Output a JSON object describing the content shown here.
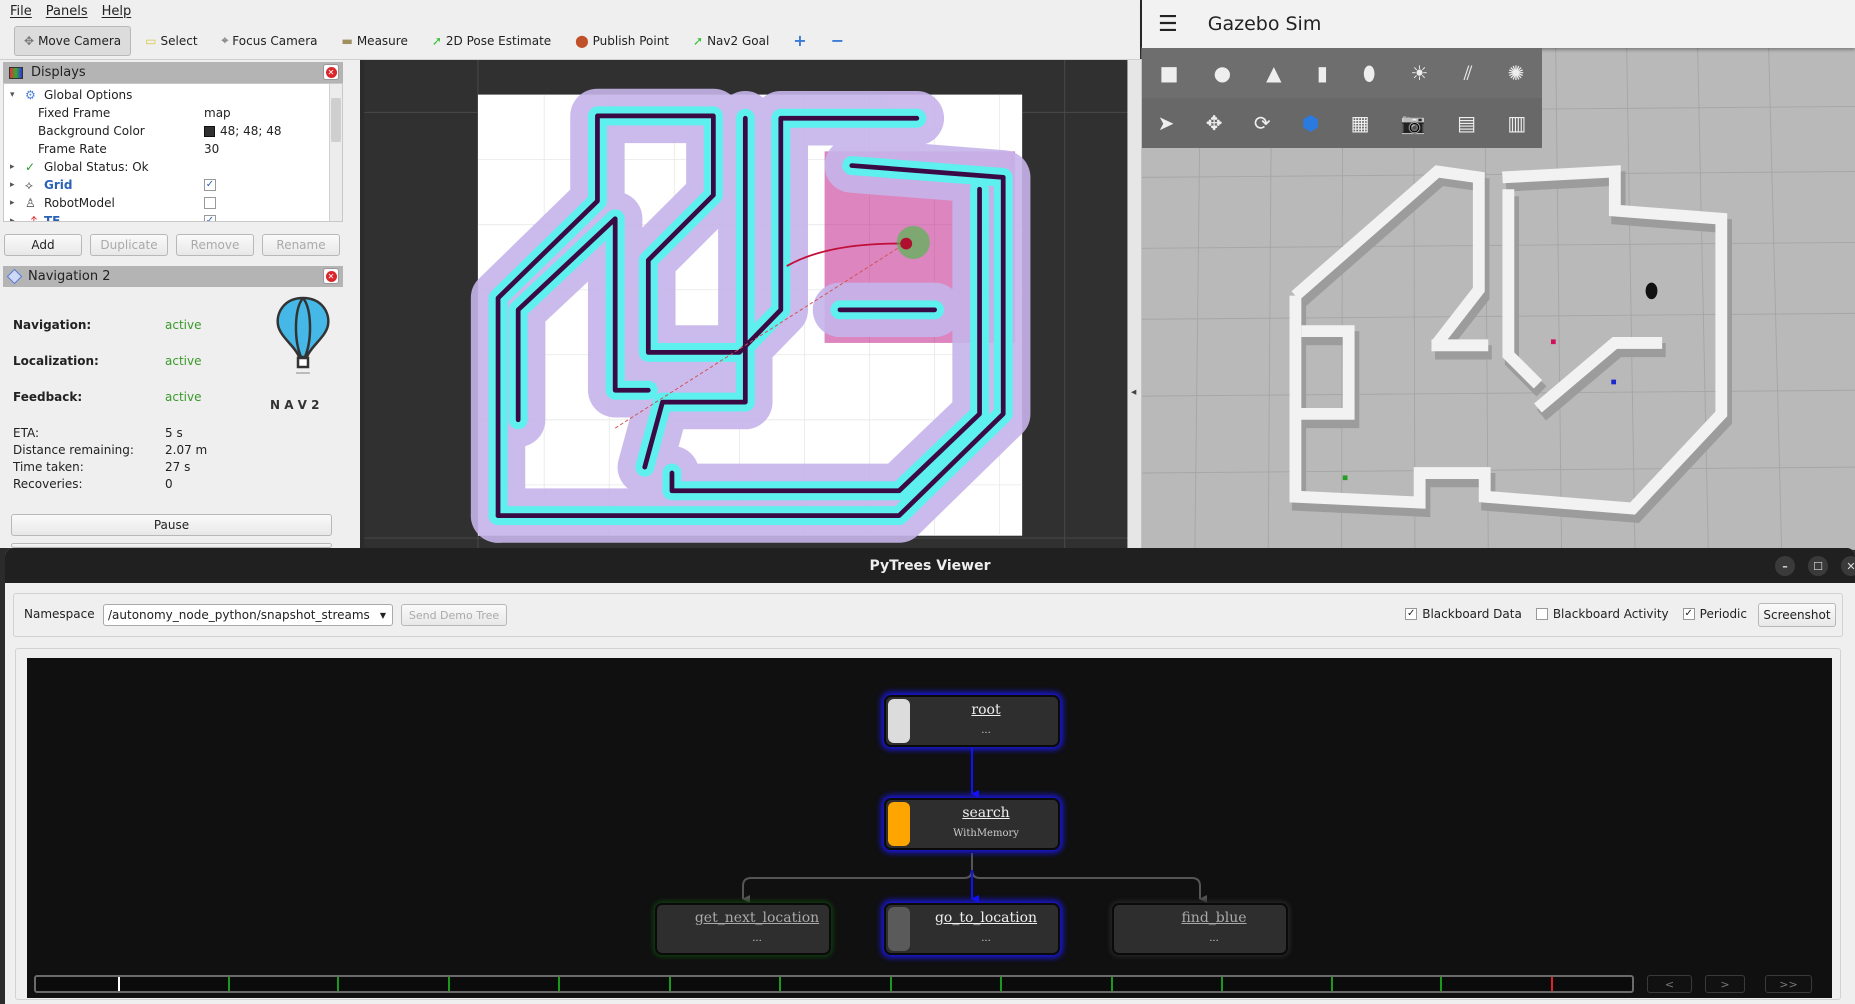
{
  "rviz": {
    "menu": [
      "File",
      "Panels",
      "Help"
    ],
    "tools": [
      {
        "label": "Move Camera",
        "icon": "move-camera-icon",
        "glyph": "✥"
      },
      {
        "label": "Select",
        "icon": "select-icon",
        "glyph": "▭"
      },
      {
        "label": "Focus Camera",
        "icon": "focus-camera-icon",
        "glyph": "⌖"
      },
      {
        "label": "Measure",
        "icon": "ruler-icon",
        "glyph": "▬"
      },
      {
        "label": "2D Pose Estimate",
        "icon": "pose-arrow-icon",
        "glyph": "➚"
      },
      {
        "label": "Publish Point",
        "icon": "map-pin-icon",
        "glyph": "⬤"
      },
      {
        "label": "Nav2 Goal",
        "icon": "goal-arrow-icon",
        "glyph": "➚"
      },
      {
        "label": "",
        "icon": "plus-icon",
        "glyph": "+"
      },
      {
        "label": "",
        "icon": "minus-icon",
        "glyph": "−"
      }
    ],
    "displays": {
      "title": "Displays",
      "rows": [
        {
          "label": "Global Options",
          "value": ""
        },
        {
          "label": "Fixed Frame",
          "value": "map"
        },
        {
          "label": "Background Color",
          "value": "48; 48; 48"
        },
        {
          "label": "Frame Rate",
          "value": "30"
        },
        {
          "label": "Global Status: Ok",
          "value": ""
        },
        {
          "label": "Grid",
          "value": "✓"
        },
        {
          "label": "RobotModel",
          "value": ""
        },
        {
          "label": "TF",
          "value": "✓"
        }
      ],
      "buttons": [
        "Add",
        "Duplicate",
        "Remove",
        "Rename"
      ]
    },
    "nav2": {
      "title": "Navigation 2",
      "status": [
        {
          "label": "Navigation:",
          "value": "active"
        },
        {
          "label": "Localization:",
          "value": "active"
        },
        {
          "label": "Feedback:",
          "value": "active"
        }
      ],
      "stats": [
        {
          "label": "ETA:",
          "value": "5 s"
        },
        {
          "label": "Distance remaining:",
          "value": "2.07 m"
        },
        {
          "label": "Time taken:",
          "value": "27 s"
        },
        {
          "label": "Recoveries:",
          "value": "0"
        }
      ],
      "logo_text": "N A V 2",
      "pause": "Pause",
      "active_color": "#3a9a2a"
    }
  },
  "gazebo": {
    "title": "Gazebo Sim",
    "shapes": [
      "box-icon",
      "sphere-icon",
      "cone-icon",
      "cylinder-icon",
      "capsule-icon",
      "point-light-icon",
      "directional-light-icon",
      "spot-light-icon"
    ],
    "tools": [
      "select-arrow-icon",
      "translate-icon",
      "rotate-icon",
      "transform-control-icon",
      "grid-snap-icon",
      "camera-screenshot-icon",
      "copy-icon",
      "paste-icon"
    ]
  },
  "pytrees": {
    "title": "PyTrees Viewer",
    "namespace_label": "Namespace",
    "namespace_value": "/autonomy_node_python/snapshot_streams",
    "send_demo": "Send Demo Tree",
    "checks": [
      {
        "label": "Blackboard Data",
        "checked": true
      },
      {
        "label": "Blackboard Activity",
        "checked": false
      },
      {
        "label": "Periodic",
        "checked": true
      }
    ],
    "screenshot": "Screenshot",
    "nodes": [
      {
        "name": "root",
        "sub": "...",
        "color": "#dcdcdc"
      },
      {
        "name": "search",
        "sub": "WithMemory",
        "color": "#ffa500"
      },
      {
        "name": "get_next_location",
        "sub": "...",
        "color": "#2e2e2e"
      },
      {
        "name": "go_to_location",
        "sub": "...",
        "color": "#5a5a5a"
      },
      {
        "name": "find_blue",
        "sub": "...",
        "color": "#2e2e2e"
      }
    ],
    "nav_buttons": [
      "<",
      ">",
      ">>"
    ]
  }
}
